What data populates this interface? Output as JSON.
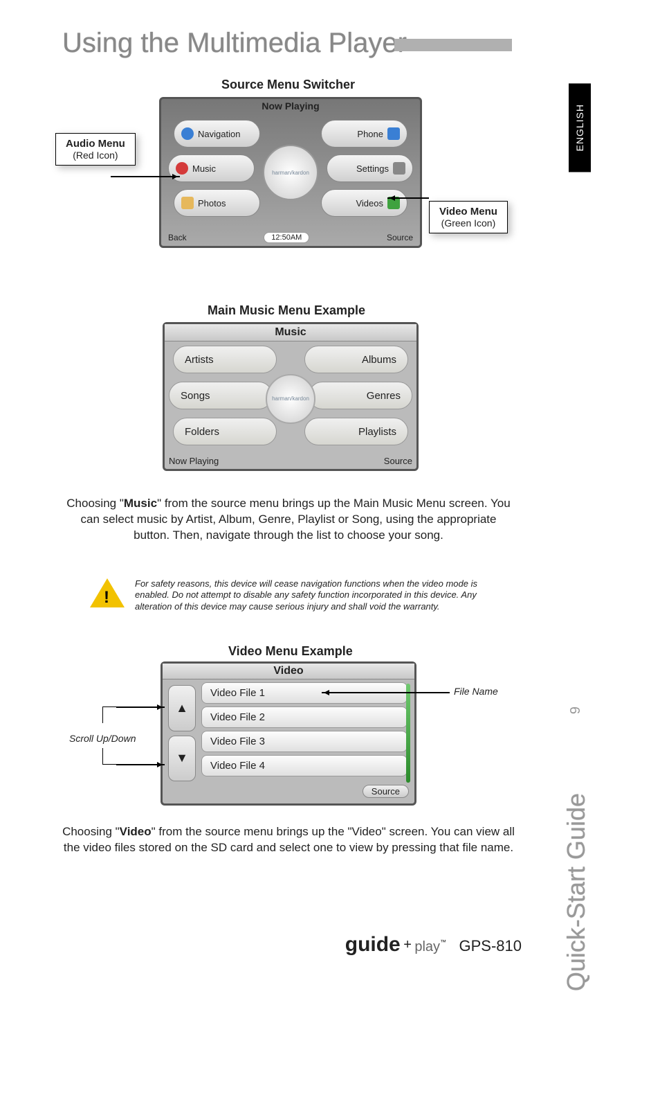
{
  "page_title": "Using the Multimedia Player",
  "language_tab": "ENGLISH",
  "side_guide": "Quick-Start Guide",
  "page_number": "9",
  "section1": {
    "label": "Source Menu Switcher",
    "now_playing": "Now Playing",
    "center": "harman/kardon",
    "time": "12:50AM",
    "back": "Back",
    "source": "Source",
    "buttons": {
      "navigation": "Navigation",
      "phone": "Phone",
      "music": "Music",
      "settings": "Settings",
      "photos": "Photos",
      "videos": "Videos"
    },
    "callout_audio_title": "Audio Menu",
    "callout_audio_sub": "(Red Icon)",
    "callout_video_title": "Video Menu",
    "callout_video_sub": "(Green Icon)"
  },
  "section2": {
    "label": "Main Music Menu Example",
    "title": "Music",
    "center": "harman/kardon",
    "now_playing": "Now Playing",
    "source": "Source",
    "buttons": {
      "artists": "Artists",
      "albums": "Albums",
      "songs": "Songs",
      "genres": "Genres",
      "folders": "Folders",
      "playlists": "Playlists"
    }
  },
  "para1_pre": "Choosing  \"",
  "para1_bold": "Music",
  "para1_post": "\" from the source menu brings up the  Main Music Menu screen.  You can select music by Artist, Album, Genre, Playlist or Song, using the appropriate button. Then, navigate through the list to choose your song.",
  "warning": "For safety reasons, this device will cease navigation functions when the video mode is enabled.  Do not attempt to disable any safety function incorporated in this device.  Any alteration of this device may cause serious injury and shall void the warranty.",
  "section3": {
    "label": "Video Menu Example",
    "title": "Video",
    "files": [
      "Video File 1",
      "Video File 2",
      "Video File 3",
      "Video File 4"
    ],
    "source": "Source",
    "callout_file": "File Name",
    "callout_scroll": "Scroll Up/Down",
    "arrow_up": "▲",
    "arrow_down": "▼"
  },
  "para2_pre": "Choosing  \"",
  "para2_bold": "Video",
  "para2_post": "\" from the source menu brings up the  \"Video\" screen.  You can view all the video files stored on the SD card and select one to view by pressing that file name.",
  "footer": {
    "guide": "guide",
    "plus": "+",
    "play": "play",
    "tm": "™",
    "model": "GPS-810"
  }
}
